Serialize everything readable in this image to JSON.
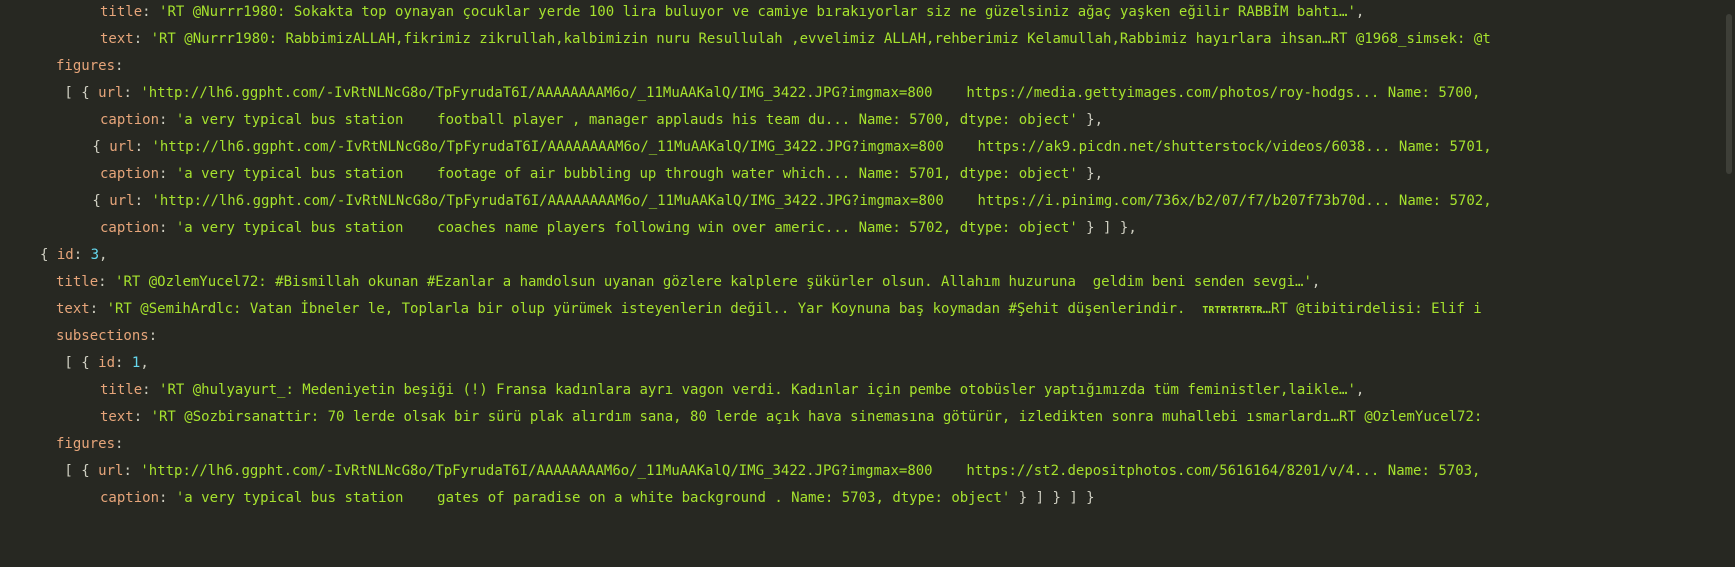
{
  "lines": [
    {
      "indent": 4,
      "tokens": [
        {
          "t": "key",
          "v": "title"
        },
        {
          "t": "punct",
          "v": ": "
        },
        {
          "t": "str",
          "v": "'RT @Nurrr1980: Sokakta top oynayan çocuklar yerde 100 lira buluyor ve camiye bırakıyorlar siz ne güzelsiniz ağaç yaşken eğilir RABBİM bahtı…'"
        },
        {
          "t": "punct",
          "v": ","
        }
      ]
    },
    {
      "indent": 4,
      "tokens": [
        {
          "t": "key",
          "v": "text"
        },
        {
          "t": "punct",
          "v": ": "
        },
        {
          "t": "str",
          "v": "'RT @Nurrr1980: RabbimizALLAH,fikrimiz zikrullah,kalbimizin nuru Resullulah ,evvelimiz ALLAH,rehberimiz Kelamullah,Rabbimiz hayırlara ihsan…RT @1968_simsek: @t"
        }
      ]
    },
    {
      "indent": 1,
      "tokens": [
        {
          "t": "key",
          "v": "figures"
        },
        {
          "t": "punct",
          "v": ":"
        }
      ]
    },
    {
      "indent": 1,
      "tokens": [
        {
          "t": "punct",
          "v": " [ { "
        },
        {
          "t": "key",
          "v": "url"
        },
        {
          "t": "punct",
          "v": ": "
        },
        {
          "t": "str",
          "v": "'http://lh6.ggpht.com/-IvRtNLNcG8o/TpFyrudaT6I/AAAAAAAAM6o/_11MuAAKalQ/IMG_3422.JPG?imgmax=800    https://media.gettyimages.com/photos/roy-hodgs... Name: 5700,"
        }
      ]
    },
    {
      "indent": 4,
      "tokens": [
        {
          "t": "key",
          "v": "caption"
        },
        {
          "t": "punct",
          "v": ": "
        },
        {
          "t": "str",
          "v": "'a very typical bus station    football player , manager applauds his team du... Name: 5700, dtype: object'"
        },
        {
          "t": "punct",
          "v": " },"
        }
      ]
    },
    {
      "indent": 3,
      "tokens": [
        {
          "t": "punct",
          "v": " { "
        },
        {
          "t": "key",
          "v": "url"
        },
        {
          "t": "punct",
          "v": ": "
        },
        {
          "t": "str",
          "v": "'http://lh6.ggpht.com/-IvRtNLNcG8o/TpFyrudaT6I/AAAAAAAAM6o/_11MuAAKalQ/IMG_3422.JPG?imgmax=800    https://ak9.picdn.net/shutterstock/videos/6038... Name: 5701,"
        }
      ]
    },
    {
      "indent": 4,
      "tokens": [
        {
          "t": "key",
          "v": "caption"
        },
        {
          "t": "punct",
          "v": ": "
        },
        {
          "t": "str",
          "v": "'a very typical bus station    footage of air bubbling up through water which... Name: 5701, dtype: object'"
        },
        {
          "t": "punct",
          "v": " },"
        }
      ]
    },
    {
      "indent": 3,
      "tokens": [
        {
          "t": "punct",
          "v": " { "
        },
        {
          "t": "key",
          "v": "url"
        },
        {
          "t": "punct",
          "v": ": "
        },
        {
          "t": "str",
          "v": "'http://lh6.ggpht.com/-IvRtNLNcG8o/TpFyrudaT6I/AAAAAAAAM6o/_11MuAAKalQ/IMG_3422.JPG?imgmax=800    https://i.pinimg.com/736x/b2/07/f7/b207f73b70d... Name: 5702,"
        }
      ]
    },
    {
      "indent": 4,
      "tokens": [
        {
          "t": "key",
          "v": "caption"
        },
        {
          "t": "punct",
          "v": ": "
        },
        {
          "t": "str",
          "v": "'a very typical bus station    coaches name players following win over americ... Name: 5702, dtype: object'"
        },
        {
          "t": "punct",
          "v": " } ] },"
        }
      ]
    },
    {
      "indent": 0,
      "tokens": [
        {
          "t": "punct",
          "v": "{ "
        },
        {
          "t": "key",
          "v": "id"
        },
        {
          "t": "punct",
          "v": ": "
        },
        {
          "t": "num",
          "v": "3"
        },
        {
          "t": "punct",
          "v": ","
        }
      ]
    },
    {
      "indent": 1,
      "tokens": [
        {
          "t": "key",
          "v": "title"
        },
        {
          "t": "punct",
          "v": ": "
        },
        {
          "t": "str",
          "v": "'RT @OzlemYucel72: #Bismillah okunan #Ezanlar a hamdolsun uyanan gözlere kalplere şükürler olsun. Allahım huzuruna  geldim beni senden sevgi…'"
        },
        {
          "t": "punct",
          "v": ","
        }
      ]
    },
    {
      "indent": 1,
      "tokens": [
        {
          "t": "key",
          "v": "text"
        },
        {
          "t": "punct",
          "v": ": "
        },
        {
          "t": "str",
          "v": "'RT @SemihArdlc: Vatan İbneler le, Toplarla bir olup yürümek isteyenlerin değil.. Yar Koynuna baş koymadan #Şehit düşenlerindir.  "
        },
        {
          "t": "small",
          "v": "TRTRTRTRTR"
        },
        {
          "t": "str",
          "v": "…RT @tibitirdelisi: Elif i"
        }
      ]
    },
    {
      "indent": 1,
      "tokens": [
        {
          "t": "key",
          "v": "subsections"
        },
        {
          "t": "punct",
          "v": ":"
        }
      ]
    },
    {
      "indent": 1,
      "tokens": [
        {
          "t": "punct",
          "v": " [ { "
        },
        {
          "t": "key",
          "v": "id"
        },
        {
          "t": "punct",
          "v": ": "
        },
        {
          "t": "num",
          "v": "1"
        },
        {
          "t": "punct",
          "v": ","
        }
      ]
    },
    {
      "indent": 4,
      "tokens": [
        {
          "t": "key",
          "v": "title"
        },
        {
          "t": "punct",
          "v": ": "
        },
        {
          "t": "str",
          "v": "'RT @hulyayurt_: Medeniyetin beşiği (!) Fransa kadınlara ayrı vagon verdi. Kadınlar için pembe otobüsler yaptığımızda tüm feministler,laikle…'"
        },
        {
          "t": "punct",
          "v": ","
        }
      ]
    },
    {
      "indent": 4,
      "tokens": [
        {
          "t": "key",
          "v": "text"
        },
        {
          "t": "punct",
          "v": ": "
        },
        {
          "t": "str",
          "v": "'RT @Sozbirsanattir: 70 lerde olsak bir sürü plak alırdım sana, 80 lerde açık hava sinemasına götürür, izledikten sonra muhallebi ısmarlardı…RT @OzlemYucel72:"
        }
      ]
    },
    {
      "indent": 1,
      "tokens": [
        {
          "t": "key",
          "v": "figures"
        },
        {
          "t": "punct",
          "v": ":"
        }
      ]
    },
    {
      "indent": 1,
      "tokens": [
        {
          "t": "punct",
          "v": " [ { "
        },
        {
          "t": "key",
          "v": "url"
        },
        {
          "t": "punct",
          "v": ": "
        },
        {
          "t": "str",
          "v": "'http://lh6.ggpht.com/-IvRtNLNcG8o/TpFyrudaT6I/AAAAAAAAM6o/_11MuAAKalQ/IMG_3422.JPG?imgmax=800    https://st2.depositphotos.com/5616164/8201/v/4... Name: 5703,"
        }
      ]
    },
    {
      "indent": 4,
      "tokens": [
        {
          "t": "key",
          "v": "caption"
        },
        {
          "t": "punct",
          "v": ": "
        },
        {
          "t": "str",
          "v": "'a very typical bus station    gates of paradise on a white background . Name: 5703, dtype: object'"
        },
        {
          "t": "punct",
          "v": " } ] } ] }"
        }
      ]
    }
  ],
  "colors": {
    "background": "#272822",
    "key": "#e6a57a",
    "string": "#a6e22e",
    "number": "#66d9ef",
    "punctuation": "#cfcfc2"
  }
}
